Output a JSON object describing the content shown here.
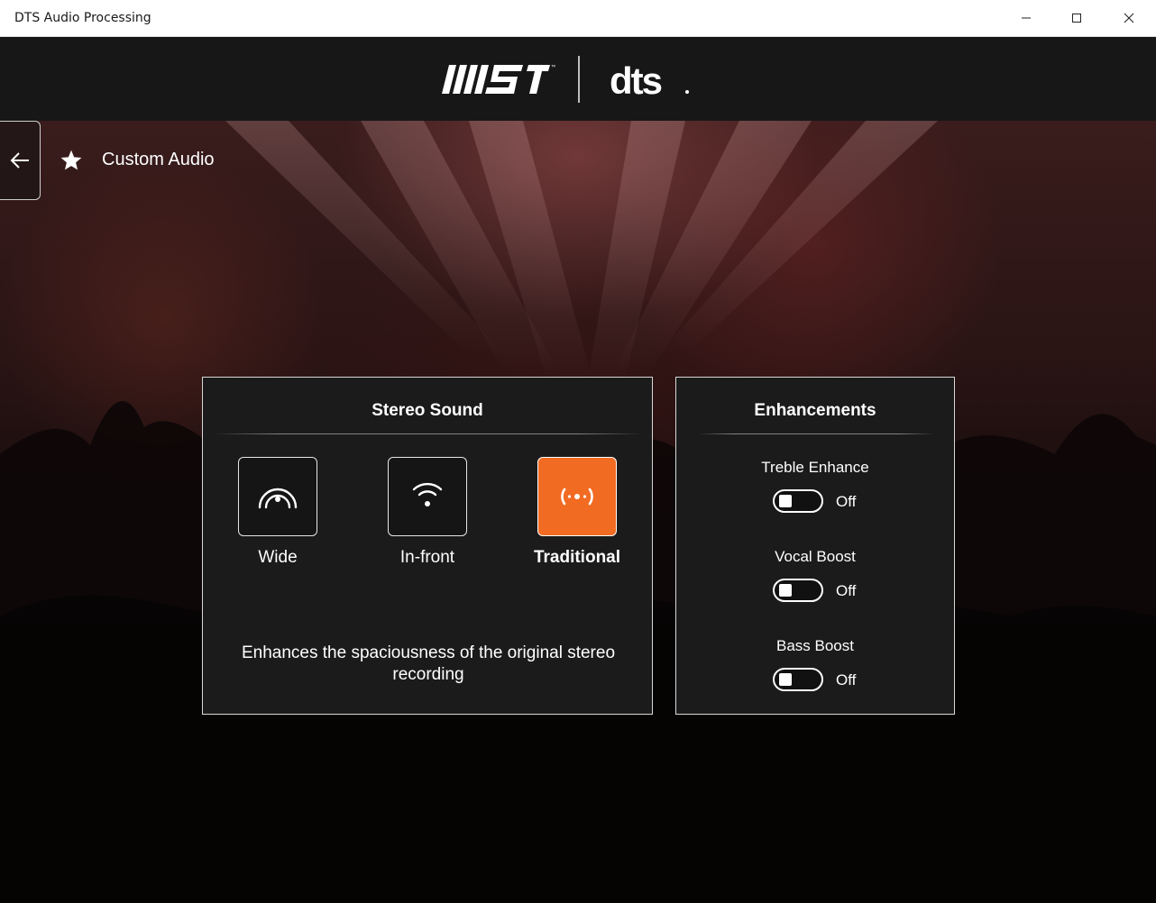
{
  "window": {
    "title": "DTS Audio Processing",
    "controls": [
      "minimize",
      "maximize",
      "close"
    ]
  },
  "brand": {
    "logos": [
      "msi-logo",
      "dts-logo"
    ],
    "msi_text": "MSI",
    "dts_text": "dts"
  },
  "header": {
    "back_icon": "arrow-left-icon",
    "mode_icon": "star-icon",
    "title": "Custom Audio"
  },
  "stereo": {
    "title": "Stereo Sound",
    "modes": [
      {
        "label": "Wide",
        "icon": "wide-icon",
        "selected": false
      },
      {
        "label": "In-front",
        "icon": "in-front-icon",
        "selected": false
      },
      {
        "label": "Traditional",
        "icon": "traditional-icon",
        "selected": true
      }
    ],
    "description": "Enhances the spaciousness of the original stereo recording"
  },
  "enhancements": {
    "title": "Enhancements",
    "items": [
      {
        "label": "Treble Enhance",
        "state": "Off",
        "on": false
      },
      {
        "label": "Vocal Boost",
        "state": "Off",
        "on": false
      },
      {
        "label": "Bass Boost",
        "state": "Off",
        "on": false
      }
    ]
  },
  "colors": {
    "accent": "#f26b22",
    "panel_bg": "#1b1b1b",
    "logo_band": "#171717"
  }
}
